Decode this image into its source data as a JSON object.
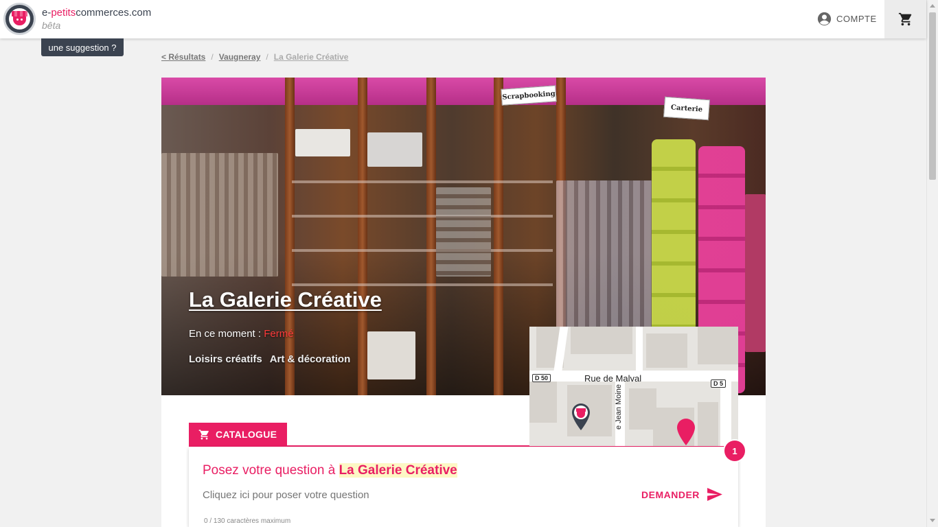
{
  "header": {
    "brand_prefix": "e-",
    "brand_highlight": "petits",
    "brand_suffix": "commerces.com",
    "beta_label": "bêta",
    "account_label": "COMPTE",
    "account_icon": "account-circle-icon",
    "cart_icon": "cart-icon"
  },
  "suggestion_label": "une suggestion ?",
  "breadcrumb": {
    "results": "< Résultats",
    "city": "Vaugneray",
    "current": "La Galerie Créative",
    "separator": "/"
  },
  "shop": {
    "name": "La Galerie Créative",
    "status_prefix": "En ce moment :",
    "status_value": "Fermé",
    "categories": [
      "Loisirs créatifs",
      "Art & décoration"
    ],
    "photo_signs": [
      "Scrapbooking",
      "Carterie"
    ]
  },
  "map": {
    "street_label": "Rue de Malval",
    "side_street_label": "e Jean Moine",
    "route_badge": "D 50",
    "route_badge_right": "D 5"
  },
  "catalogue_tab": {
    "label": "CATALOGUE",
    "icon": "cart-icon"
  },
  "question": {
    "prefix": "Posez votre question à",
    "shop_name": "La Galerie Créative",
    "placeholder": "Cliquez ici pour poser votre question",
    "ask_label": "DEMANDER",
    "counter": "0 / 130 caractères maximum"
  },
  "notification_badge": "1",
  "colors": {
    "accent": "#e91e63",
    "dark": "#3b4350",
    "closed": "#ff3b3b"
  }
}
